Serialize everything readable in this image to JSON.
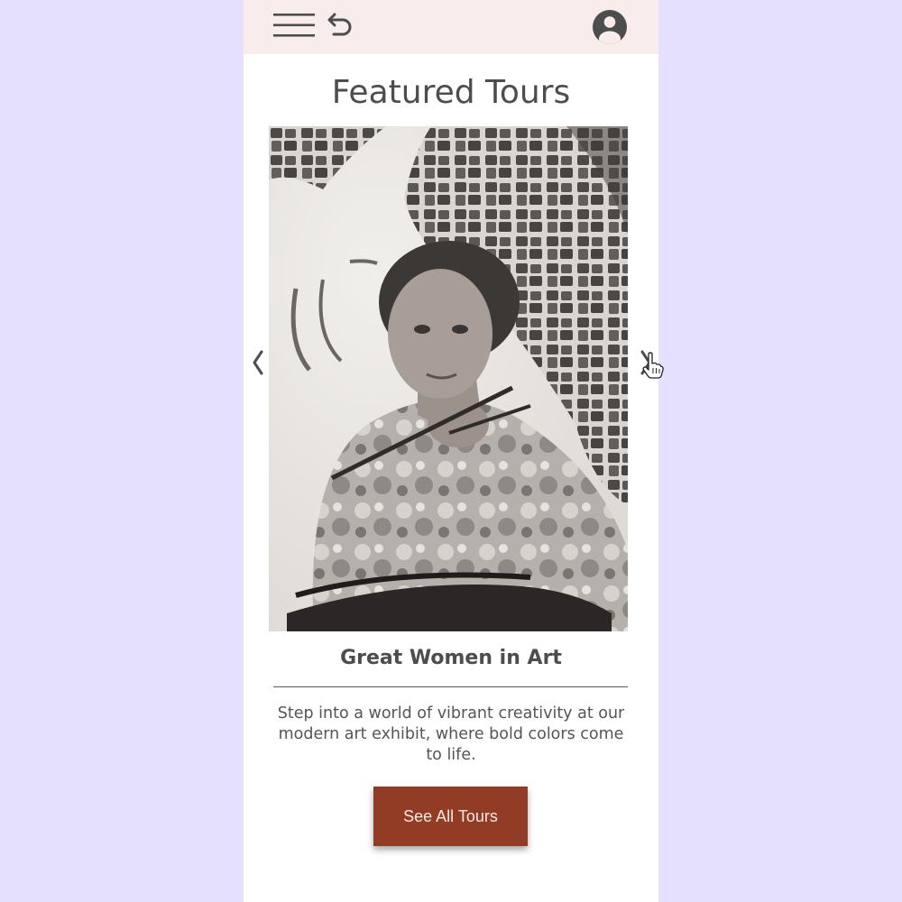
{
  "header": {
    "menu_icon": "hamburger-menu-icon",
    "back_icon": "undo-back-icon",
    "account_icon": "account-circle-icon"
  },
  "page": {
    "title": "Featured Tours"
  },
  "carousel": {
    "prev_icon": "chevron-left-icon",
    "next_icon": "chevron-right-icon",
    "image": "Black-and-white photograph of an older woman artist holding paintbrushes in front of a mosaic mural",
    "tour_title": "Great Women in Art",
    "tour_description": "Step into a world of vibrant creativity at our modern art exhibit, where bold colors come to life."
  },
  "actions": {
    "see_all_label": "See All Tours"
  },
  "colors": {
    "background": "#e5e0fd",
    "header_bg": "#f8ecec",
    "button_bg": "#933c25",
    "text": "#4d4d4d"
  }
}
